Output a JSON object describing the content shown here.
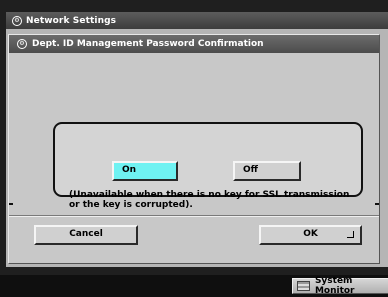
{
  "window": {
    "title": "Network Settings",
    "icon": "settings-circle-icon"
  },
  "dialog": {
    "title": "Dept. ID Management Password Confirmation",
    "icon": "settings-circle-icon"
  },
  "options": {
    "on_label": "On",
    "off_label": "Off",
    "selected": "On",
    "note": "(Unavailable when there is no key for SSL transmission or the key is corrupted)."
  },
  "actions": {
    "cancel_label": "Cancel",
    "ok_label": "OK"
  },
  "status_bar": {
    "system_monitor_label": "System Monitor"
  },
  "colors": {
    "selected_button": "#6ff2f2",
    "panel": "#c8c8c8",
    "title_bar": "#4c4c4c"
  }
}
